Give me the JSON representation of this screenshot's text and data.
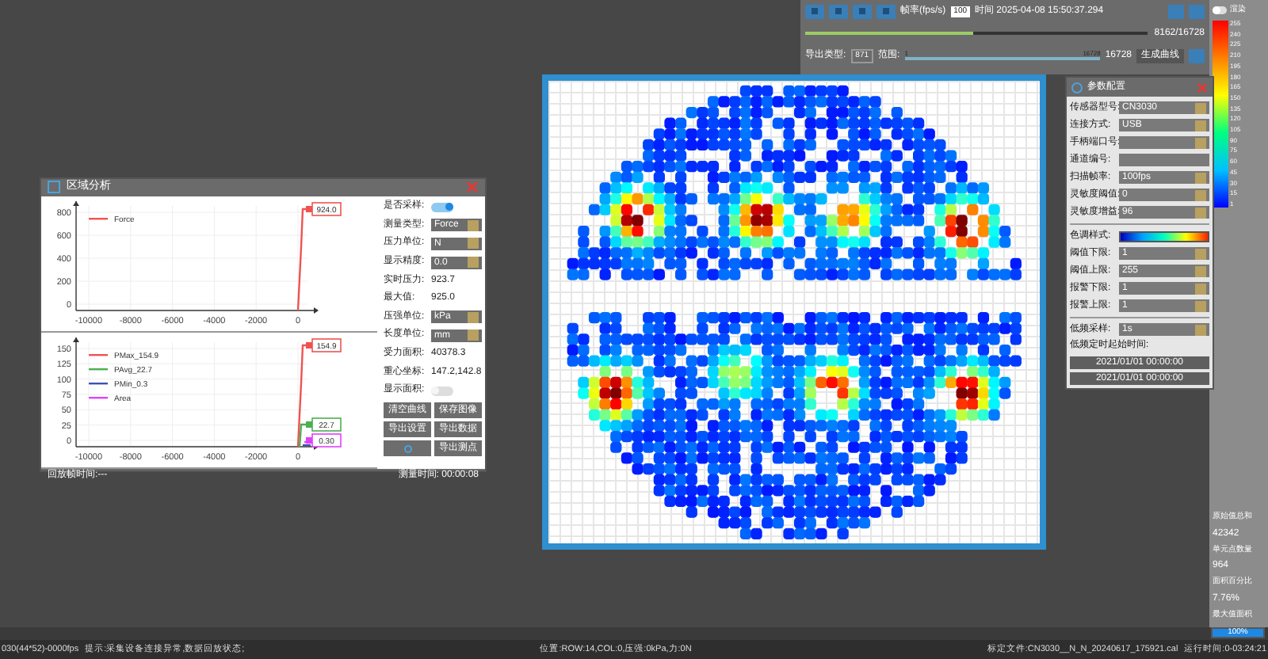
{
  "analysis_window": {
    "title": "区域分析",
    "charts": [
      {
        "legend": [
          {
            "name": "Force",
            "color": "#ef5350"
          }
        ],
        "xticks": [
          "-10000",
          "-8000",
          "-6000",
          "-4000",
          "-2000",
          "0"
        ],
        "yticks": [
          "800",
          "600",
          "400",
          "200",
          "0"
        ],
        "markers": [
          {
            "text": "924.0",
            "color": "#ef5350"
          }
        ]
      },
      {
        "legend": [
          {
            "name": "PMax_154.9",
            "color": "#ef5350"
          },
          {
            "name": "PAvg_22.7",
            "color": "#4caf50"
          },
          {
            "name": "PMin_0.3",
            "color": "#3f51b5"
          },
          {
            "name": "Area",
            "color": "#e040fb"
          }
        ],
        "xticks": [
          "-10000",
          "-8000",
          "-6000",
          "-4000",
          "-2000",
          "0"
        ],
        "yticks": [
          "150",
          "125",
          "100",
          "75",
          "50",
          "25",
          "0"
        ],
        "markers": [
          {
            "text": "154.9",
            "color": "#ef5350"
          },
          {
            "text": "22.7",
            "color": "#4caf50"
          },
          {
            "text": "0.30",
            "color": "#e040fb"
          }
        ]
      }
    ],
    "controls": [
      {
        "kind": "toggle",
        "label": "是否采样:",
        "on": true
      },
      {
        "kind": "select",
        "label": "测量类型:",
        "value": "Force"
      },
      {
        "kind": "select",
        "label": "压力单位:",
        "value": "N"
      },
      {
        "kind": "select",
        "label": "显示精度:",
        "value": "0.0"
      },
      {
        "kind": "value",
        "label": "实时压力:",
        "value": "923.7"
      },
      {
        "kind": "value",
        "label": "最大值:",
        "value": "925.0"
      },
      {
        "kind": "select",
        "label": "压强单位:",
        "value": "kPa"
      },
      {
        "kind": "select",
        "label": "长度单位:",
        "value": "mm"
      },
      {
        "kind": "value",
        "label": "受力面积:",
        "value": "40378.3"
      },
      {
        "kind": "value",
        "label": "重心坐标:",
        "value": "147.2,142.8"
      },
      {
        "kind": "toggle",
        "label": "显示面积:",
        "on": false
      }
    ],
    "buttons": [
      {
        "kind": "text",
        "label": "清空曲线"
      },
      {
        "kind": "text",
        "label": "保存图像"
      },
      {
        "kind": "text",
        "label": "导出设置"
      },
      {
        "kind": "text",
        "label": "导出数据"
      },
      {
        "kind": "icon"
      },
      {
        "kind": "text",
        "label": "导出测点"
      }
    ],
    "footer_left": "回放帧时间:---",
    "footer_right": "测量时间: 00:00:08"
  },
  "playback": {
    "fps_label": "帧率(fps/s)",
    "fps": "100",
    "time": "时间 2025-04-08 15:50:37.294",
    "frame_slider": {
      "level": 0.49
    },
    "frame_reading": "8162/16728",
    "export_type_label": "导出类型:",
    "export_type": "871",
    "range_label": "范围:",
    "range_start": "1",
    "range_end": "16728",
    "range_slider": {
      "level": 1
    },
    "range_reading": "16728",
    "generate_button": "生成曲线"
  },
  "render_toggle": {
    "label": "渲染",
    "on": false
  },
  "colorbar": {
    "ticks": [
      "255",
      "240",
      "225",
      "210",
      "195",
      "180",
      "165",
      "150",
      "135",
      "120",
      "105",
      "90",
      "75",
      "60",
      "45",
      "30",
      "15",
      "1"
    ]
  },
  "params_window": {
    "title": "参数配置",
    "rows": [
      {
        "kind": "select",
        "label": "传感器型号:",
        "value": "CN3030"
      },
      {
        "kind": "select",
        "label": "连接方式:",
        "value": "USB"
      },
      {
        "kind": "select",
        "label": "手柄端口号:"
      },
      {
        "kind": "text",
        "label": "通道编号:"
      },
      {
        "kind": "spin",
        "label": "扫描帧率:",
        "value": "100fps"
      },
      {
        "kind": "spin",
        "label": "灵敏度阈值:",
        "value": "0"
      },
      {
        "kind": "spin",
        "label": "灵敏度增益:",
        "value": "96"
      },
      {
        "kind": "divider"
      },
      {
        "kind": "gradient",
        "label": "色调样式:"
      },
      {
        "kind": "spin",
        "label": "阈值下限:",
        "value": "1"
      },
      {
        "kind": "spin",
        "label": "阈值上限:",
        "value": "255"
      },
      {
        "kind": "spin",
        "label": "报警下限:",
        "value": "1"
      },
      {
        "kind": "spin",
        "label": "报警上限:",
        "value": "1"
      },
      {
        "kind": "divider"
      },
      {
        "kind": "spin",
        "label": "低频采样:",
        "value": "1s"
      },
      {
        "kind": "caption",
        "label": "低频定时起始时间:"
      },
      {
        "kind": "date",
        "value": "2021/01/01 00:00:00"
      },
      {
        "kind": "date",
        "value": "2021/01/01 00:00:00"
      }
    ]
  },
  "stats": [
    {
      "label": "原始值总和",
      "value": "42342"
    },
    {
      "label": "单元点数量",
      "value": "964"
    },
    {
      "label": "面积百分比",
      "value": "7.76%"
    }
  ],
  "stats_last_label": "最大值面积",
  "progress": {
    "level": 1,
    "text": "100%"
  },
  "status_bar": [
    "030(44*52)-0000fps",
    "提示:采集设备连接异常,数据回放状态;",
    "位置:ROW:14,COL:0,压强:0kPa,力:0N",
    "标定文件:CN3030__N_N_20240617_175921.cal",
    "运行时间:0-03:24:21"
  ]
}
